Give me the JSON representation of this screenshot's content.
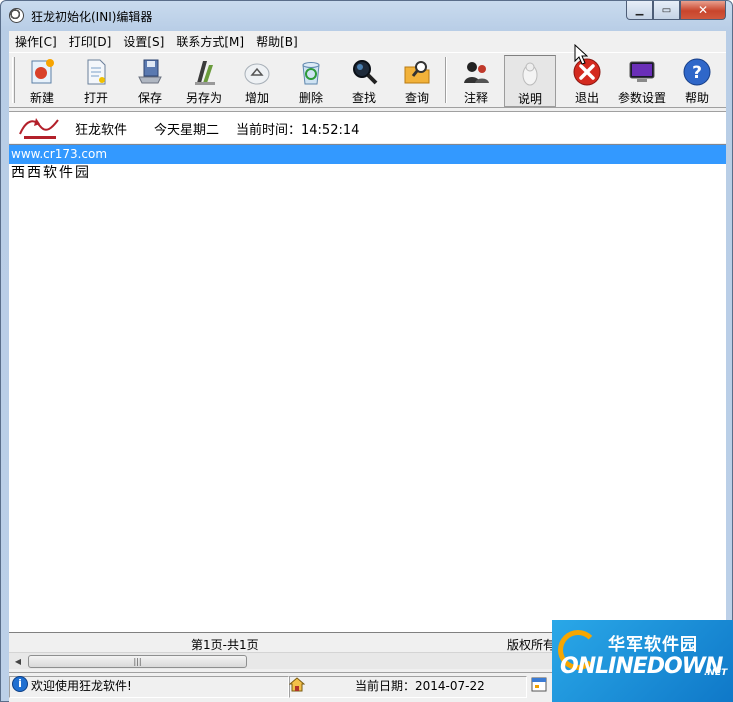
{
  "window": {
    "title": "狂龙初始化(INI)编辑器"
  },
  "menu": [
    {
      "label": "操作[C]"
    },
    {
      "label": "打印[D]"
    },
    {
      "label": "设置[S]"
    },
    {
      "label": "联系方式[M]"
    },
    {
      "label": "帮助[B]"
    }
  ],
  "toolbar": {
    "new": "新建",
    "open": "打开",
    "save": "保存",
    "saveas": "另存为",
    "add": "增加",
    "delete": "删除",
    "find": "查找",
    "query": "查询",
    "comment": "注释",
    "explain": "说明",
    "exit": "退出",
    "params": "参数设置",
    "help": "帮助"
  },
  "infobar": {
    "brand": "狂龙软件",
    "weekday": "今天星期二",
    "time": "当前时间：14:52:14"
  },
  "list": {
    "rows": [
      "www.cr173.com",
      "西西软件园"
    ]
  },
  "pagebar": {
    "page": "第1页-共1页",
    "copyright": "版权所有"
  },
  "status": {
    "welcome": "欢迎使用狂龙软件!",
    "date": "当前日期：2014-07-22"
  },
  "watermark": {
    "cn": "华军软件园",
    "en": "ONLINEDOWN",
    "suffix": ".NET"
  }
}
